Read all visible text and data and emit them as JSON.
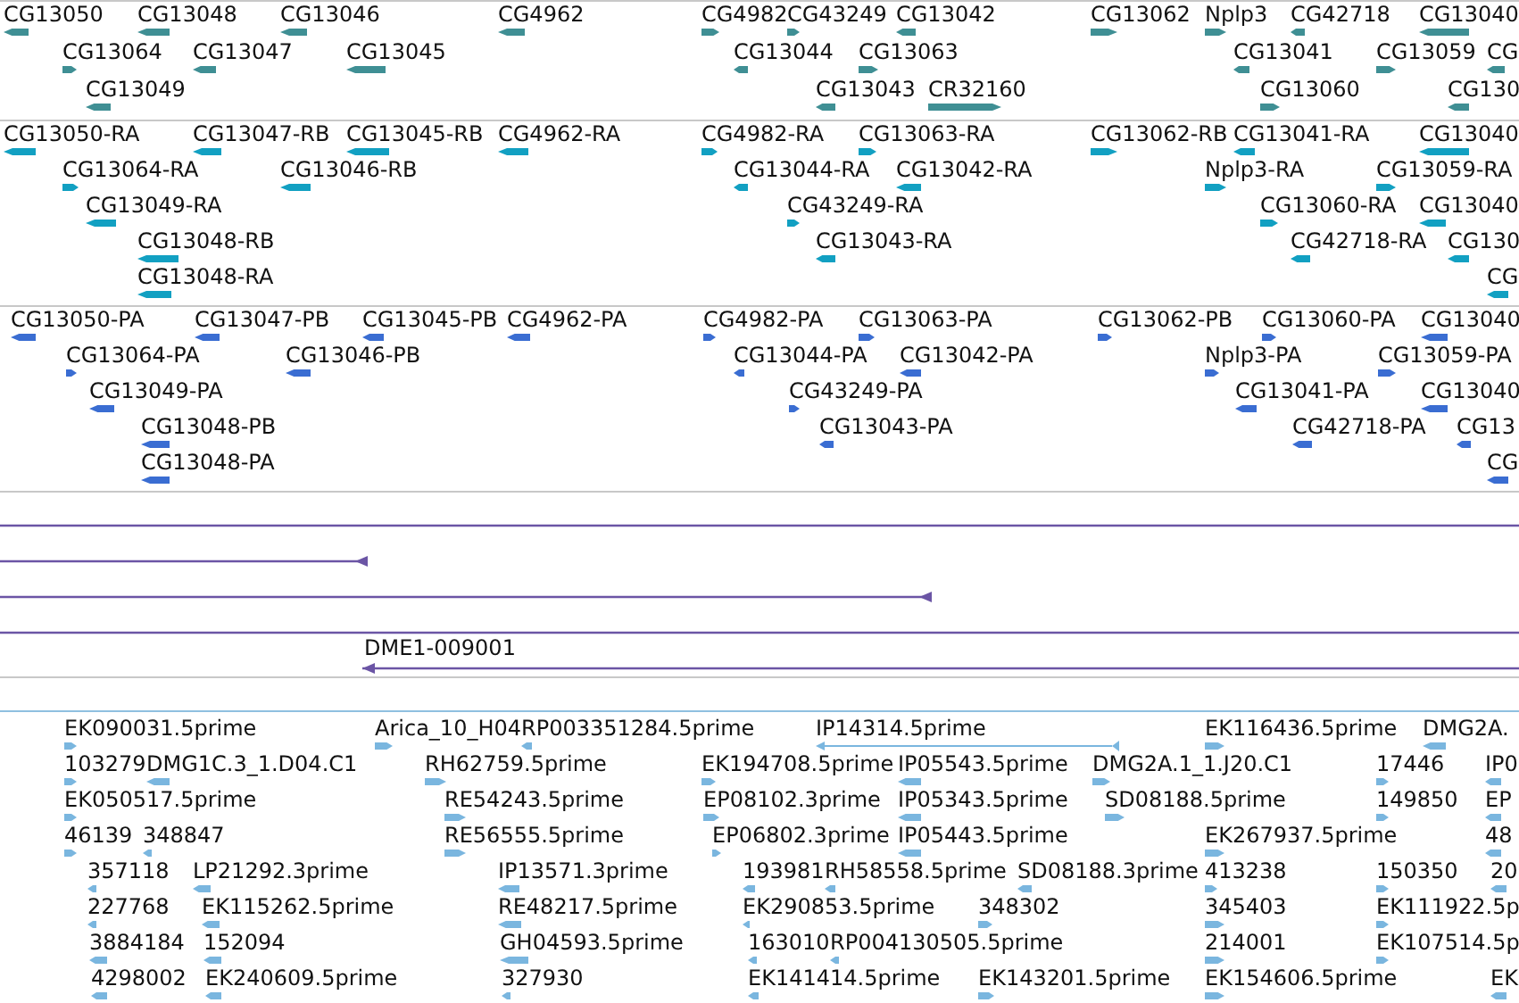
{
  "tracks": [
    {
      "color": "#3f8f94",
      "features": [
        {
          "label": "CG13050",
          "reverse": true
        },
        {
          "label": "CG13048",
          "reverse": true
        },
        {
          "label": "CG13046",
          "reverse": true
        },
        {
          "label": "CG4962",
          "reverse": true
        },
        {
          "label": "CG4982",
          "reverse": false
        },
        {
          "label": "CG43249",
          "reverse": false
        },
        {
          "label": "CG13042",
          "reverse": true
        },
        {
          "label": "CG13062",
          "reverse": false
        },
        {
          "label": "Nplp3",
          "reverse": false
        },
        {
          "label": "CG42718",
          "reverse": true
        },
        {
          "label": "CG13040",
          "reverse": true
        },
        {
          "label": "CG13064",
          "reverse": false
        },
        {
          "label": "CG13047",
          "reverse": true
        },
        {
          "label": "CG13045",
          "reverse": true
        },
        {
          "label": "CG13044",
          "reverse": true
        },
        {
          "label": "CG13063",
          "reverse": false
        },
        {
          "label": "CG13041",
          "reverse": true
        },
        {
          "label": "CG13059",
          "reverse": false
        },
        {
          "label": "CG",
          "reverse": true
        },
        {
          "label": "CG13049",
          "reverse": true
        },
        {
          "label": "CG13043",
          "reverse": true
        },
        {
          "label": "CR32160",
          "reverse": false
        },
        {
          "label": "CG13060",
          "reverse": false
        },
        {
          "label": "CG130",
          "reverse": true
        }
      ]
    },
    {
      "color": "#12a0c2",
      "features": [
        {
          "label": "CG13050-RA",
          "reverse": true
        },
        {
          "label": "CG13047-RB",
          "reverse": true
        },
        {
          "label": "CG13045-RB",
          "reverse": true
        },
        {
          "label": "CG4962-RA",
          "reverse": true
        },
        {
          "label": "CG4982-RA",
          "reverse": false
        },
        {
          "label": "CG13063-RA",
          "reverse": false
        },
        {
          "label": "CG13062-RB",
          "reverse": false
        },
        {
          "label": "CG13041-RA",
          "reverse": true
        },
        {
          "label": "CG13040",
          "reverse": true
        },
        {
          "label": "CG13064-RA",
          "reverse": false
        },
        {
          "label": "CG13046-RB",
          "reverse": true
        },
        {
          "label": "CG13044-RA",
          "reverse": true
        },
        {
          "label": "CG13042-RA",
          "reverse": true
        },
        {
          "label": "Nplp3-RA",
          "reverse": false
        },
        {
          "label": "CG13059-RA",
          "reverse": false
        },
        {
          "label": "CG13049-RA",
          "reverse": true
        },
        {
          "label": "CG43249-RA",
          "reverse": false
        },
        {
          "label": "CG13060-RA",
          "reverse": false
        },
        {
          "label": "CG13040",
          "reverse": true
        },
        {
          "label": "CG13048-RB",
          "reverse": true
        },
        {
          "label": "CG13043-RA",
          "reverse": true
        },
        {
          "label": "CG42718-RA",
          "reverse": true
        },
        {
          "label": "CG130",
          "reverse": true
        },
        {
          "label": "CG13048-RA",
          "reverse": true
        },
        {
          "label": "CG",
          "reverse": true
        }
      ]
    },
    {
      "color": "#3a6dd2",
      "features": [
        {
          "label": "CG13050-PA",
          "reverse": true
        },
        {
          "label": "CG13047-PB",
          "reverse": true
        },
        {
          "label": "CG13045-PB",
          "reverse": true
        },
        {
          "label": "CG4962-PA",
          "reverse": true
        },
        {
          "label": "CG4982-PA",
          "reverse": false
        },
        {
          "label": "CG13063-PA",
          "reverse": false
        },
        {
          "label": "CG13062-PB",
          "reverse": false
        },
        {
          "label": "CG13060-PA",
          "reverse": false
        },
        {
          "label": "CG13040",
          "reverse": true
        },
        {
          "label": "CG13064-PA",
          "reverse": false
        },
        {
          "label": "CG13046-PB",
          "reverse": true
        },
        {
          "label": "CG13044-PA",
          "reverse": true
        },
        {
          "label": "CG13042-PA",
          "reverse": true
        },
        {
          "label": "Nplp3-PA",
          "reverse": false
        },
        {
          "label": "CG13059-PA",
          "reverse": false
        },
        {
          "label": "CG13049-PA",
          "reverse": true
        },
        {
          "label": "CG43249-PA",
          "reverse": false
        },
        {
          "label": "CG13041-PA",
          "reverse": true
        },
        {
          "label": "CG13040",
          "reverse": true
        },
        {
          "label": "CG13048-PB",
          "reverse": true
        },
        {
          "label": "CG13043-PA",
          "reverse": true
        },
        {
          "label": "CG42718-PA",
          "reverse": true
        },
        {
          "label": "CG13",
          "reverse": true
        },
        {
          "label": "CG13048-PA",
          "reverse": true
        },
        {
          "label": "CG",
          "reverse": true
        }
      ]
    },
    {
      "color": "#7ab6df",
      "features": [
        {
          "label": "EK090031.5prime",
          "reverse": false
        },
        {
          "label": "Arica_10_H04",
          "reverse": false
        },
        {
          "label": "RP003351284.5prime",
          "reverse": true
        },
        {
          "label": "IP14314.5prime",
          "reverse": true
        },
        {
          "label": "EK116436.5prime",
          "reverse": false
        },
        {
          "label": "DMG2A.",
          "reverse": true
        },
        {
          "label": "103279",
          "reverse": false
        },
        {
          "label": "DMG1C.3_1.D04.C1",
          "reverse": true
        },
        {
          "label": "RH62759.5prime",
          "reverse": false
        },
        {
          "label": "EK194708.5prime",
          "reverse": false
        },
        {
          "label": "IP05543.5prime",
          "reverse": true
        },
        {
          "label": "DMG2A.1_1.J20.C1",
          "reverse": false
        },
        {
          "label": "17446",
          "reverse": false
        },
        {
          "label": "IP0",
          "reverse": true
        },
        {
          "label": "EK050517.5prime",
          "reverse": false
        },
        {
          "label": "RE54243.5prime",
          "reverse": false
        },
        {
          "label": "EP08102.3prime",
          "reverse": false
        },
        {
          "label": "IP05343.5prime",
          "reverse": true
        },
        {
          "label": "SD08188.5prime",
          "reverse": false
        },
        {
          "label": "149850",
          "reverse": false
        },
        {
          "label": "EP",
          "reverse": true
        },
        {
          "label": "46139",
          "reverse": false
        },
        {
          "label": "348847",
          "reverse": true
        },
        {
          "label": "RE56555.5prime",
          "reverse": false
        },
        {
          "label": "EP06802.3prime",
          "reverse": false
        },
        {
          "label": "IP05443.5prime",
          "reverse": true
        },
        {
          "label": "EK267937.5prime",
          "reverse": false
        },
        {
          "label": "48",
          "reverse": true
        },
        {
          "label": "357118",
          "reverse": true
        },
        {
          "label": "LP21292.3prime",
          "reverse": true
        },
        {
          "label": "IP13571.3prime",
          "reverse": true
        },
        {
          "label": "193981",
          "reverse": true
        },
        {
          "label": "RH58558.5prime",
          "reverse": true
        },
        {
          "label": "SD08188.3prime",
          "reverse": true
        },
        {
          "label": "413238",
          "reverse": false
        },
        {
          "label": "150350",
          "reverse": false
        },
        {
          "label": "20",
          "reverse": true
        },
        {
          "label": "227768",
          "reverse": true
        },
        {
          "label": "EK115262.5prime",
          "reverse": true
        },
        {
          "label": "RE48217.5prime",
          "reverse": true
        },
        {
          "label": "EK290853.5prime",
          "reverse": true
        },
        {
          "label": "348302",
          "reverse": false
        },
        {
          "label": "345403",
          "reverse": false
        },
        {
          "label": "EK111922.5p",
          "reverse": false
        },
        {
          "label": "3884184",
          "reverse": true
        },
        {
          "label": "152094",
          "reverse": true
        },
        {
          "label": "GH04593.5prime",
          "reverse": true
        },
        {
          "label": "163010",
          "reverse": true
        },
        {
          "label": "RP004130505.5prime",
          "reverse": true
        },
        {
          "label": "214001",
          "reverse": false
        },
        {
          "label": "EK107514.5p",
          "reverse": false
        },
        {
          "label": "4298002",
          "reverse": true
        },
        {
          "label": "EK240609.5prime",
          "reverse": true
        },
        {
          "label": "327930",
          "reverse": true
        },
        {
          "label": "EK141414.5prime",
          "reverse": true
        },
        {
          "label": "EK143201.5prime",
          "reverse": false
        },
        {
          "label": "EK154606.5prime",
          "reverse": false
        },
        {
          "label": "EK",
          "reverse": true
        }
      ]
    }
  ],
  "alignment_track": {
    "color": "#6b55a5",
    "label": "DME1-009001"
  }
}
